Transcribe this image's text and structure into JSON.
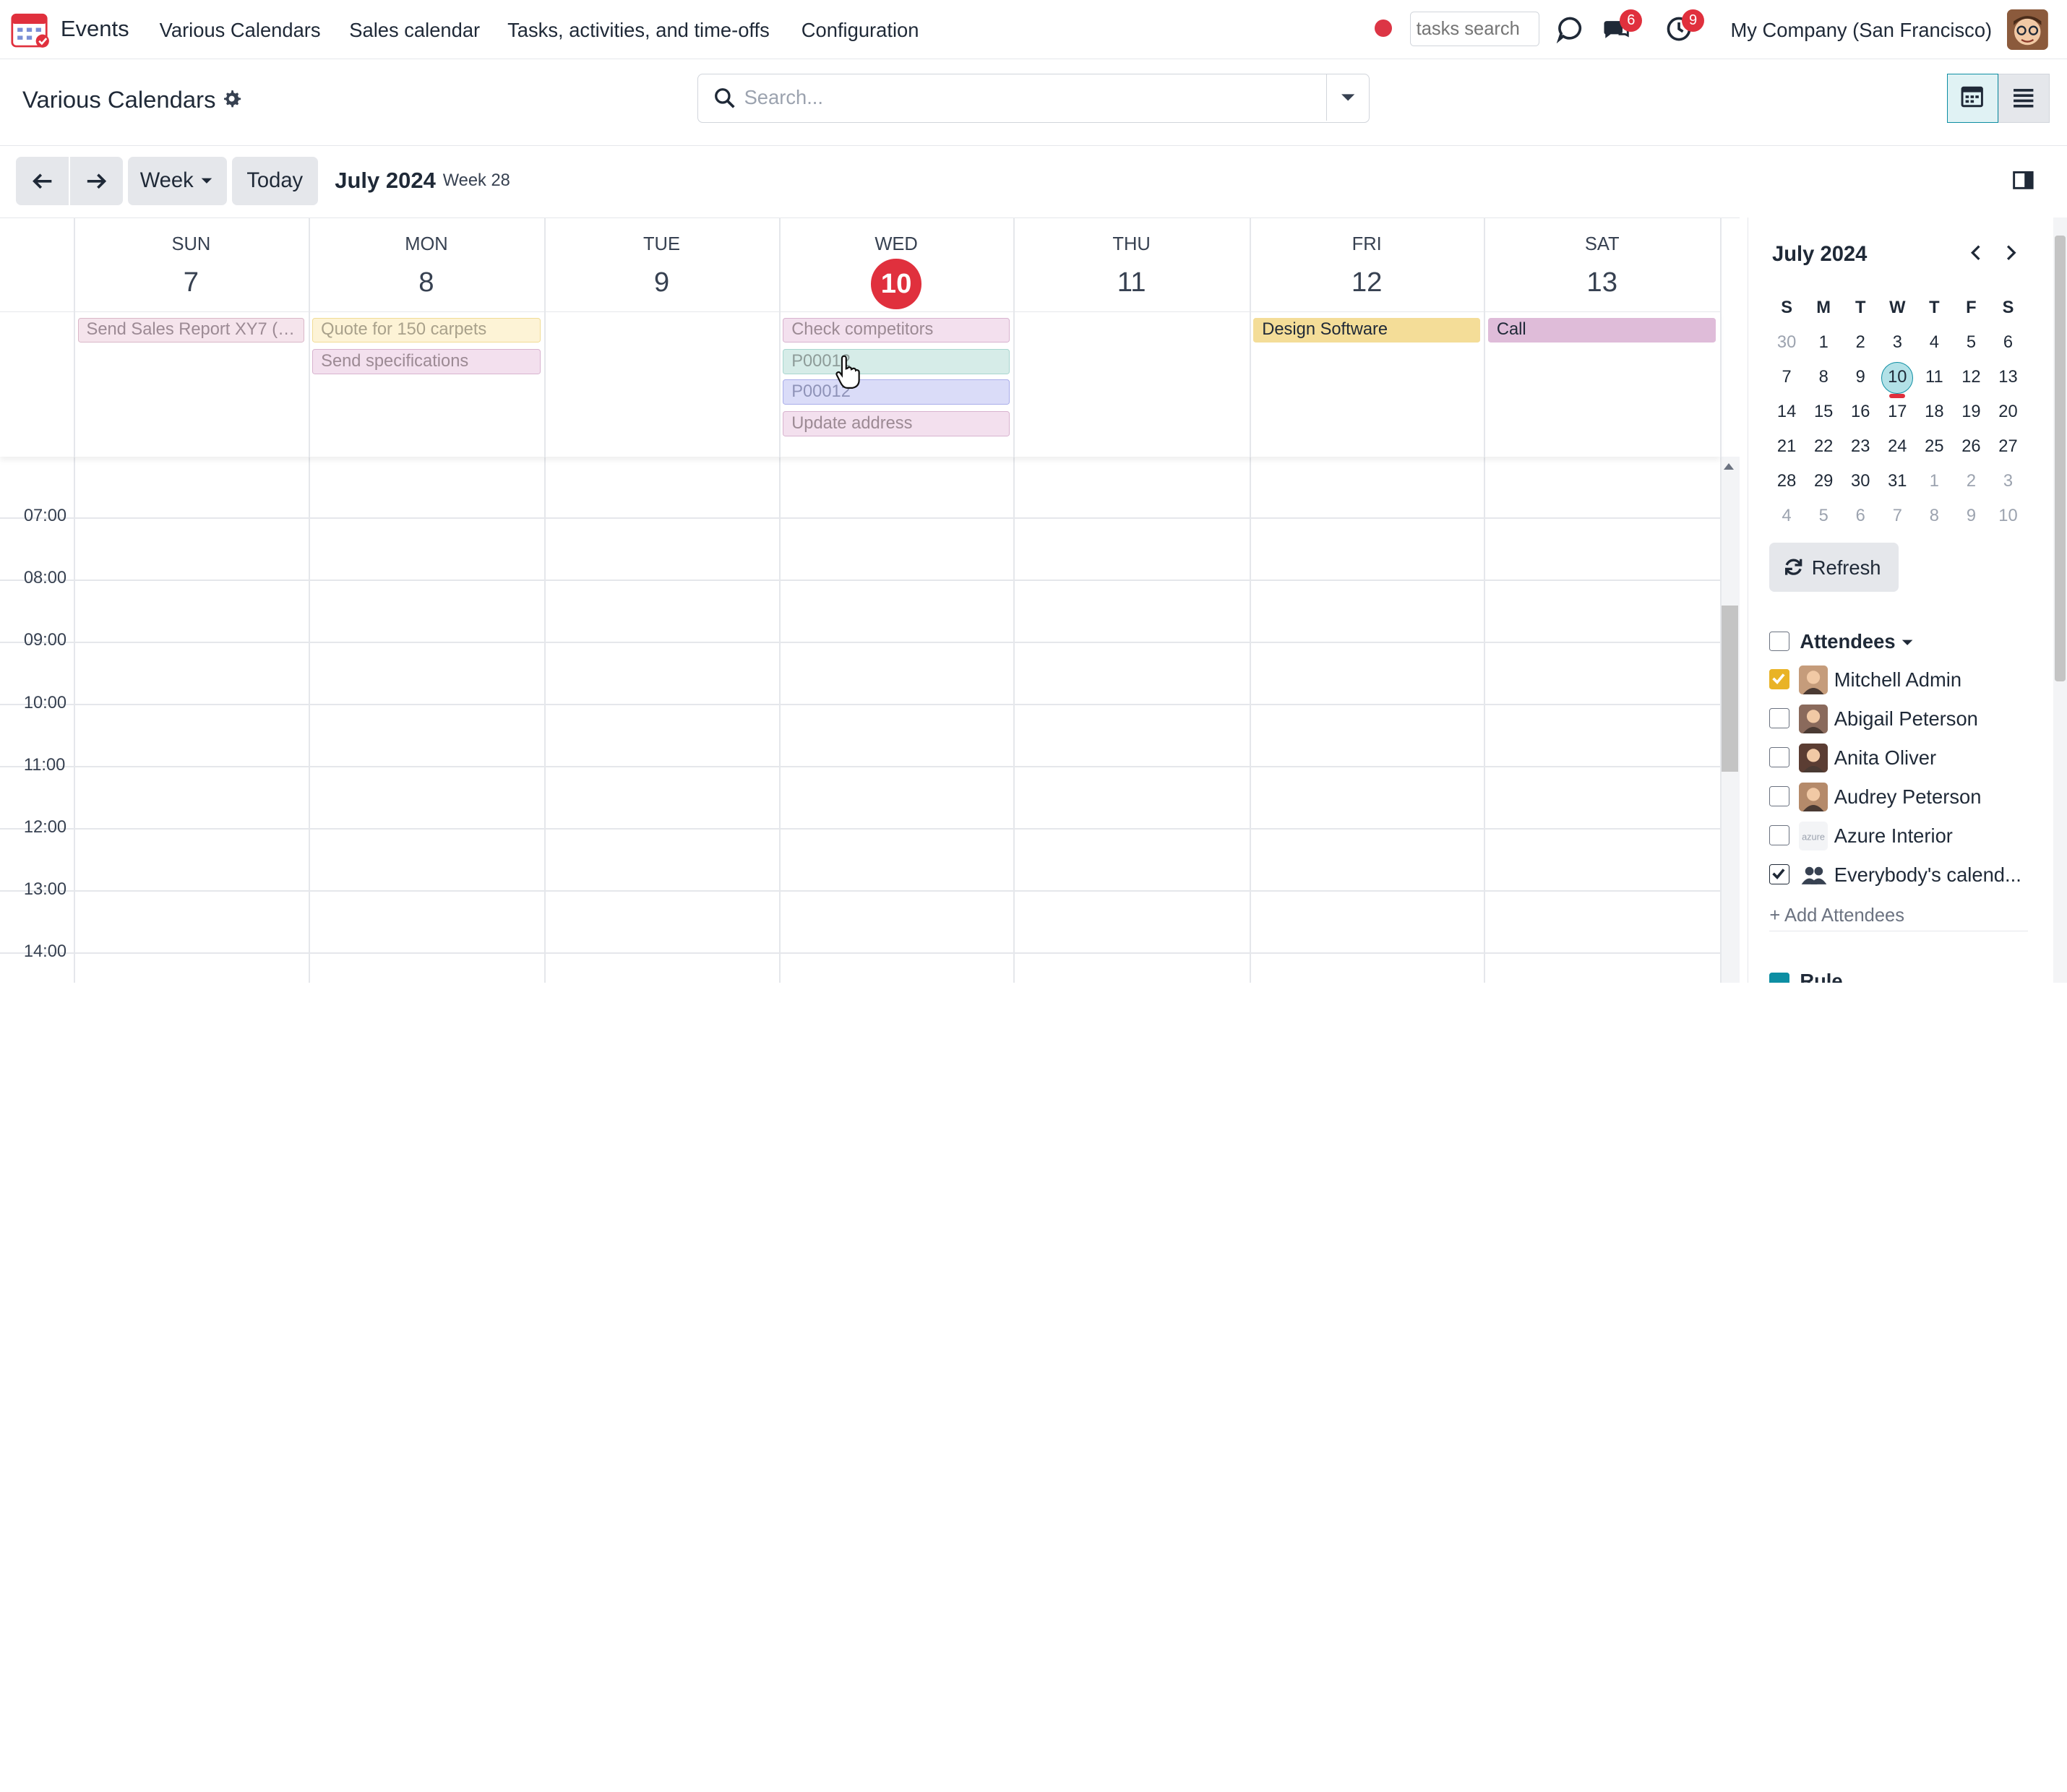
{
  "navbar": {
    "app_name": "Events",
    "menu": [
      "Various Calendars",
      "Sales calendar",
      "Tasks, activities, and time-offs",
      "Configuration"
    ],
    "tasks_search_placeholder": "tasks search",
    "messages_badge": "6",
    "activities_badge": "9",
    "company": "My Company (San Francisco)"
  },
  "control_panel": {
    "breadcrumb": "Various Calendars",
    "search_placeholder": "Search..."
  },
  "toolbar": {
    "scale_label": "Week",
    "today_label": "Today",
    "range_title": "July 2024",
    "week_label": "Week 28"
  },
  "calendar": {
    "days": [
      {
        "name": "SUN",
        "num": "7"
      },
      {
        "name": "MON",
        "num": "8"
      },
      {
        "name": "TUE",
        "num": "9"
      },
      {
        "name": "WED",
        "num": "10"
      },
      {
        "name": "THU",
        "num": "11"
      },
      {
        "name": "FRI",
        "num": "12"
      },
      {
        "name": "SAT",
        "num": "13"
      }
    ],
    "today_index": 3,
    "all_day_events": [
      {
        "day": 0,
        "slot": 0,
        "title": "Send Sales Report XY7 (m...",
        "color": "#f5e4ec",
        "text": "#9c8a94",
        "border": "#dab7c8"
      },
      {
        "day": 1,
        "slot": 0,
        "title": "Quote for 150 carpets",
        "color": "#fdf3d6",
        "text": "#a9a18b",
        "border": "#f1dc95"
      },
      {
        "day": 1,
        "slot": 1,
        "title": "Send specifications",
        "color": "#f3e0ee",
        "text": "#9c8a94",
        "border": "#d8b3cf"
      },
      {
        "day": 3,
        "slot": 0,
        "title": "Check competitors",
        "color": "#f3e0ee",
        "text": "#9c8a94",
        "border": "#d8b3cf"
      },
      {
        "day": 3,
        "slot": 1,
        "title": "P00012",
        "color": "#d6ece8",
        "text": "#8e9c99",
        "border": "#a8d6cf"
      },
      {
        "day": 3,
        "slot": 2,
        "title": "P00012",
        "color": "#dadcf8",
        "text": "#8f93b8",
        "border": "#a9ade9"
      },
      {
        "day": 3,
        "slot": 3,
        "title": "Update address",
        "color": "#f3e0ee",
        "text": "#9c8a94",
        "border": "#d8b3cf"
      },
      {
        "day": 5,
        "slot": 0,
        "title": "Design Software",
        "color": "#f4dd98",
        "text": "#1f2937",
        "border": "#f4dd98"
      },
      {
        "day": 6,
        "slot": 0,
        "title": "Call",
        "color": "#dfbcd9",
        "text": "#1f2937",
        "border": "#dfbcd9"
      }
    ],
    "hours": [
      "07:00",
      "08:00",
      "09:00",
      "10:00",
      "11:00",
      "12:00",
      "13:00",
      "14:00"
    ]
  },
  "sidebar": {
    "month_title": "July 2024",
    "weekday_heads": [
      "S",
      "M",
      "T",
      "W",
      "T",
      "F",
      "S"
    ],
    "weeks": [
      [
        "30",
        "1",
        "2",
        "3",
        "4",
        "5",
        "6"
      ],
      [
        "7",
        "8",
        "9",
        "10",
        "11",
        "12",
        "13"
      ],
      [
        "14",
        "15",
        "16",
        "17",
        "18",
        "19",
        "20"
      ],
      [
        "21",
        "22",
        "23",
        "24",
        "25",
        "26",
        "27"
      ],
      [
        "28",
        "29",
        "30",
        "31",
        "1",
        "2",
        "3"
      ],
      [
        "4",
        "5",
        "6",
        "7",
        "8",
        "9",
        "10"
      ]
    ],
    "refresh_label": "Refresh",
    "attendees_label": "Attendees",
    "attendees": [
      {
        "name": "Mitchell Admin",
        "checked": true,
        "avatar_color": "#c59c7b"
      },
      {
        "name": "Abigail Peterson",
        "checked": false,
        "avatar_color": "#8a6a5c"
      },
      {
        "name": "Anita Oliver",
        "checked": false,
        "avatar_color": "#5b3d33"
      },
      {
        "name": "Audrey Peterson",
        "checked": false,
        "avatar_color": "#b58a6a"
      },
      {
        "name": "Azure Interior",
        "checked": false,
        "avatar_color": "#f3f4f6"
      },
      {
        "name": "Everybody's calend...",
        "checked": true,
        "avatar_color": "#374151"
      }
    ],
    "add_attendees_label": "+ Add Attendees",
    "rule_label": "Rule"
  },
  "colors": {
    "accent": "#0d8ea3",
    "today": "#e0303d"
  }
}
